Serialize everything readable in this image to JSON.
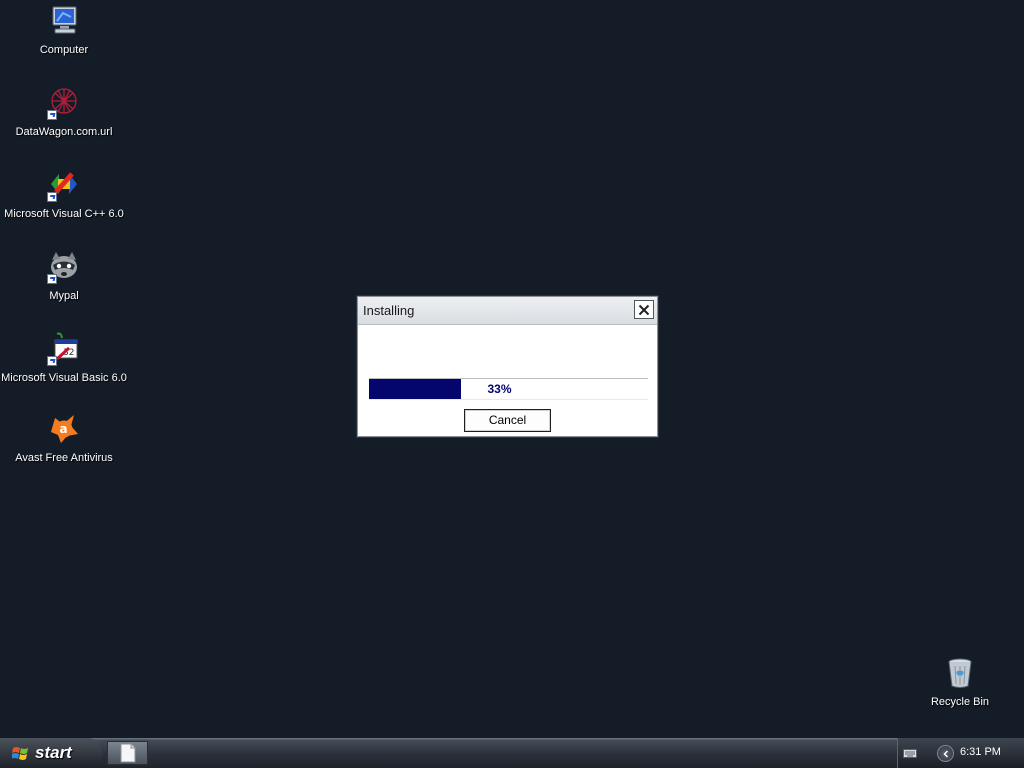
{
  "desktop": {
    "icons": [
      {
        "label": "Computer",
        "icon": "computer-icon"
      },
      {
        "label": "DataWagon.com.url",
        "icon": "datawagon-url-icon"
      },
      {
        "label": "Microsoft Visual C++ 6.0",
        "icon": "visual-cpp-icon"
      },
      {
        "label": "Mypal",
        "icon": "mypal-icon"
      },
      {
        "label": "Microsoft Visual Basic 6.0",
        "icon": "visual-basic-icon"
      },
      {
        "label": "Avast Free Antivirus",
        "icon": "avast-icon"
      }
    ],
    "recycle_bin": {
      "label": "Recycle Bin",
      "icon": "recycle-bin-icon"
    }
  },
  "dialog": {
    "title": "Installing",
    "progress_fraction": 0.33,
    "progress_text": "33%",
    "cancel_label": "Cancel",
    "close_icon": "close-icon"
  },
  "taskbar": {
    "start_label": "start",
    "task_icon": "document-icon",
    "tray": {
      "keyboard_icon": "keyboard-icon",
      "expand_icon": "chevron-left-icon",
      "clock": "6:31 PM"
    }
  },
  "colors": {
    "desktop_bg": "#141c28",
    "progress_fill": "#05056e"
  }
}
